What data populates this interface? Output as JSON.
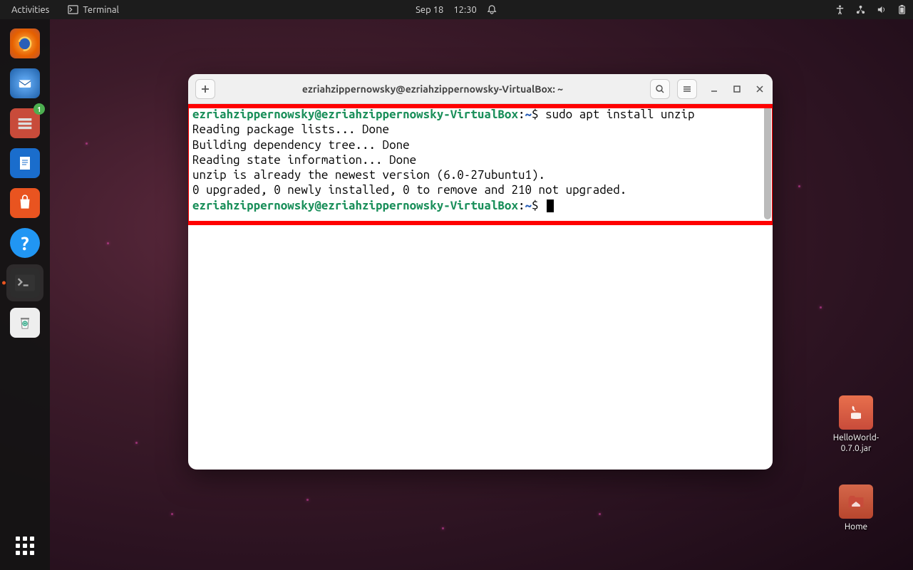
{
  "topbar": {
    "activities": "Activities",
    "app_indicator": "Terminal",
    "date": "Sep 18",
    "time": "12:30"
  },
  "dock": {
    "items": [
      {
        "name": "firefox"
      },
      {
        "name": "thunderbird"
      },
      {
        "name": "files",
        "badge": "1"
      },
      {
        "name": "writer"
      },
      {
        "name": "software"
      },
      {
        "name": "help"
      },
      {
        "name": "terminal"
      },
      {
        "name": "trash"
      }
    ]
  },
  "desktop": {
    "jar": {
      "label": "HelloWorld-0.7.0.jar"
    },
    "home": {
      "label": "Home"
    }
  },
  "terminal": {
    "title": "ezriahzippernowsky@ezriahzippernowsky-VirtualBox: ~",
    "prompt_user": "ezriahzippernowsky@ezriahzippernowsky-VirtualBox",
    "prompt_path": "~",
    "prompt_sep1": ":",
    "prompt_sep2": "$ ",
    "command1": "sudo apt install unzip",
    "line1": "Reading package lists... Done",
    "line2": "Building dependency tree... Done",
    "line3": "Reading state information... Done",
    "line4": "unzip is already the newest version (6.0-27ubuntu1).",
    "line5": "0 upgraded, 0 newly installed, 0 to remove and 210 not upgraded."
  }
}
